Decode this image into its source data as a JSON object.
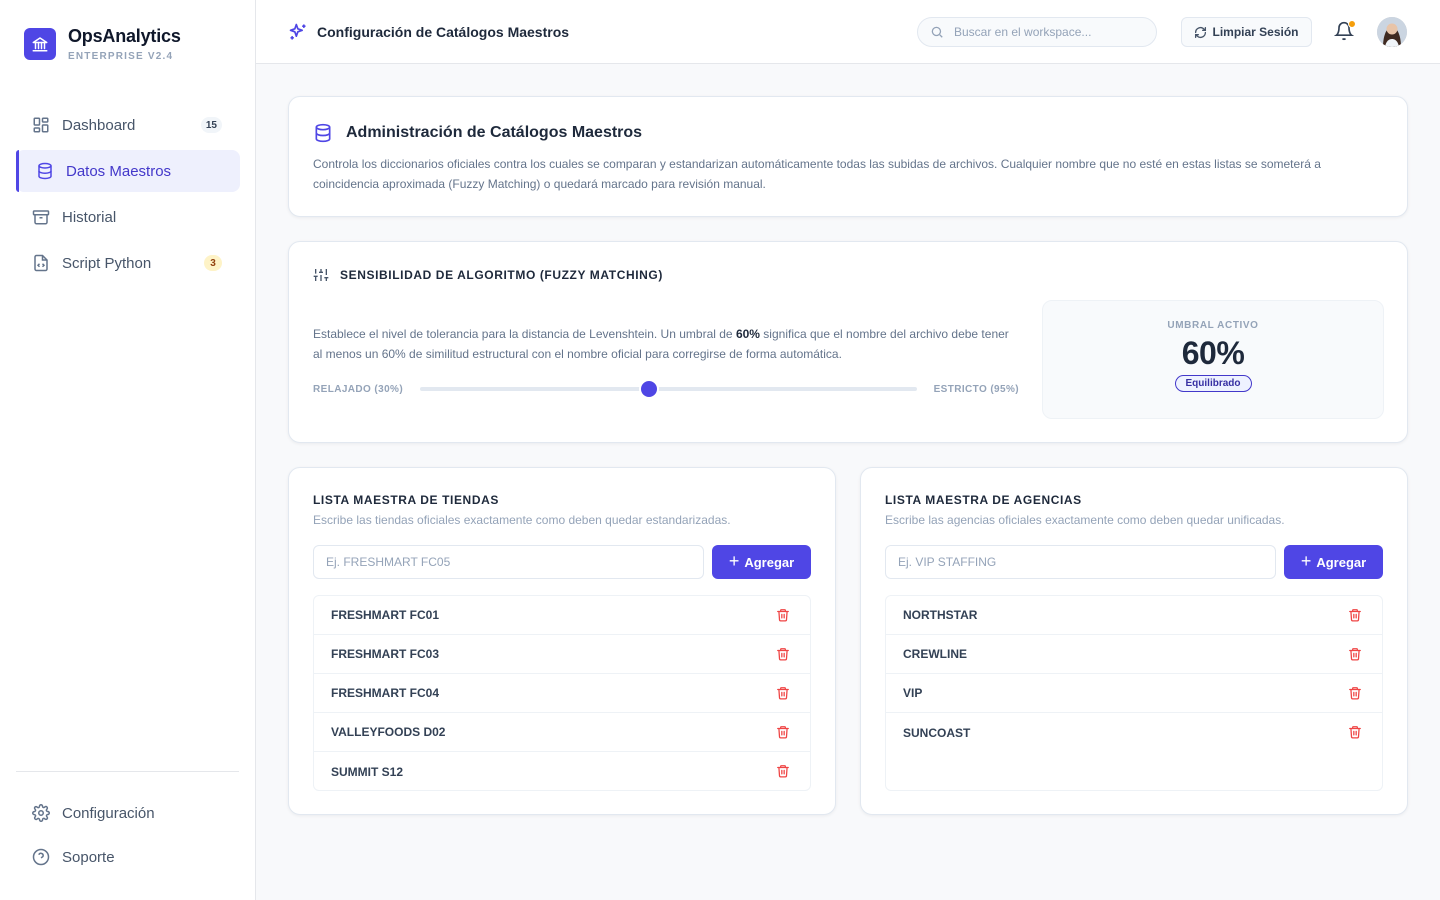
{
  "brand": {
    "name": "OpsAnalytics",
    "subtitle": "ENTERPRISE V2.4"
  },
  "nav": {
    "items": [
      {
        "label": "Dashboard",
        "badge": "15",
        "icon": "grid-icon"
      },
      {
        "label": "Datos Maestros",
        "active": true,
        "icon": "database-icon"
      },
      {
        "label": "Historial",
        "icon": "archive-icon"
      },
      {
        "label": "Script Python",
        "badge": "3",
        "icon": "file-code-icon"
      }
    ],
    "bottom": [
      {
        "label": "Configuración",
        "icon": "gear-icon"
      },
      {
        "label": "Soporte",
        "icon": "help-circle-icon"
      }
    ]
  },
  "topbar": {
    "title": "Configuración de Catálogos Maestros",
    "search_placeholder": "Buscar en el workspace...",
    "clear_label": "Limpiar Sesión"
  },
  "intro": {
    "title": "Administración de Catálogos Maestros",
    "description": "Controla los diccionarios oficiales contra los cuales se comparan y estandarizan automáticamente todas las subidas de archivos. Cualquier nombre que no esté en estas listas se someterá a coincidencia aproximada (Fuzzy Matching) o quedará marcado para revisión manual."
  },
  "sensitivity": {
    "title": "SENSIBILIDAD DE ALGORITMO (FUZZY MATCHING)",
    "desc_before": "Establece el nivel de tolerancia para la distancia de Levenshtein. Un umbral de ",
    "desc_bold": "60%",
    "desc_after": " significa que el nombre del archivo debe tener al menos un 60% de similitud estructural con el nombre oficial para corregirse de forma automática.",
    "min_label": "RELAJADO (30%)",
    "max_label": "ESTRICTO (95%)",
    "min": 30,
    "max": 95,
    "value": 60,
    "active_label": "UMBRAL ACTIVO",
    "active_value": "60%",
    "status": "Equilibrado"
  },
  "stores": {
    "title": "LISTA MAESTRA DE TIENDAS",
    "subtitle": "Escribe las tiendas oficiales exactamente como deben quedar estandarizadas.",
    "placeholder": "Ej. FRESHMART FC05",
    "add_label": "Agregar",
    "items": [
      "FRESHMART FC01",
      "FRESHMART FC03",
      "FRESHMART FC04",
      "VALLEYFOODS D02",
      "SUMMIT S12"
    ]
  },
  "agencies": {
    "title": "LISTA MAESTRA DE AGENCIAS",
    "subtitle": "Escribe las agencias oficiales exactamente como deben quedar unificadas.",
    "placeholder": "Ej. VIP STAFFING",
    "add_label": "Agregar",
    "items": [
      "NORTHSTAR",
      "CREWLINE",
      "VIP",
      "SUNCOAST"
    ]
  },
  "colors": {
    "accent": "#4f46e5",
    "danger": "#ef4444",
    "warning": "#f59e0b"
  }
}
